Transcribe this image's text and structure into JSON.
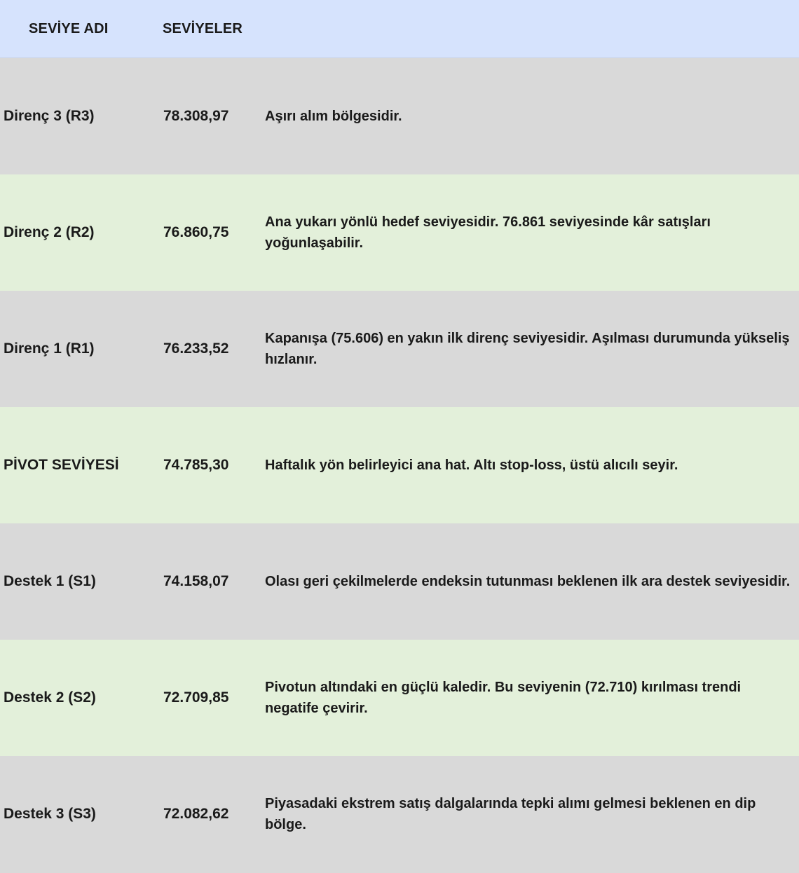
{
  "header": {
    "col_name": "SEVİYE ADI",
    "col_levels": "SEVİYELER"
  },
  "rows": [
    {
      "name": "Direnç 3 (R3)",
      "value": "78.308,97",
      "description": "Aşırı alım bölgesidir.",
      "bg": "#d9d9d9"
    },
    {
      "name": "Direnç 2 (R2)",
      "value": "76.860,75",
      "description": "Ana yukarı yönlü hedef seviyesidir. 76.861 seviyesinde kâr satışları yoğunlaşabilir.",
      "bg": "#e3f0da"
    },
    {
      "name": "Direnç 1 (R1)",
      "value": "76.233,52",
      "description": "Kapanışa (75.606) en yakın ilk direnç seviyesidir. Aşılması durumunda yükseliş hızlanır.",
      "bg": "#d9d9d9"
    },
    {
      "name": "PİVOT SEVİYESİ",
      "value": "74.785,30",
      "description": "Haftalık yön belirleyici ana hat. Altı stop-loss, üstü alıcılı seyir.",
      "bg": "#e3f0da"
    },
    {
      "name": "Destek 1 (S1)",
      "value": "74.158,07",
      "description": "Olası geri çekilmelerde endeksin tutunması beklenen ilk ara destek seviyesidir.",
      "bg": "#d9d9d9"
    },
    {
      "name": "Destek 2 (S2)",
      "value": "72.709,85",
      "description": "Pivotun altındaki en güçlü kaledir. Bu seviyenin (72.710) kırılması trendi negatife çevirir.",
      "bg": "#e3f0da"
    },
    {
      "name": "Destek 3 (S3)",
      "value": "72.082,62",
      "description": "Piyasadaki ekstrem satış dalgalarında tepki alımı gelmesi beklenen en dip bölge.",
      "bg": "#d9d9d9"
    }
  ]
}
